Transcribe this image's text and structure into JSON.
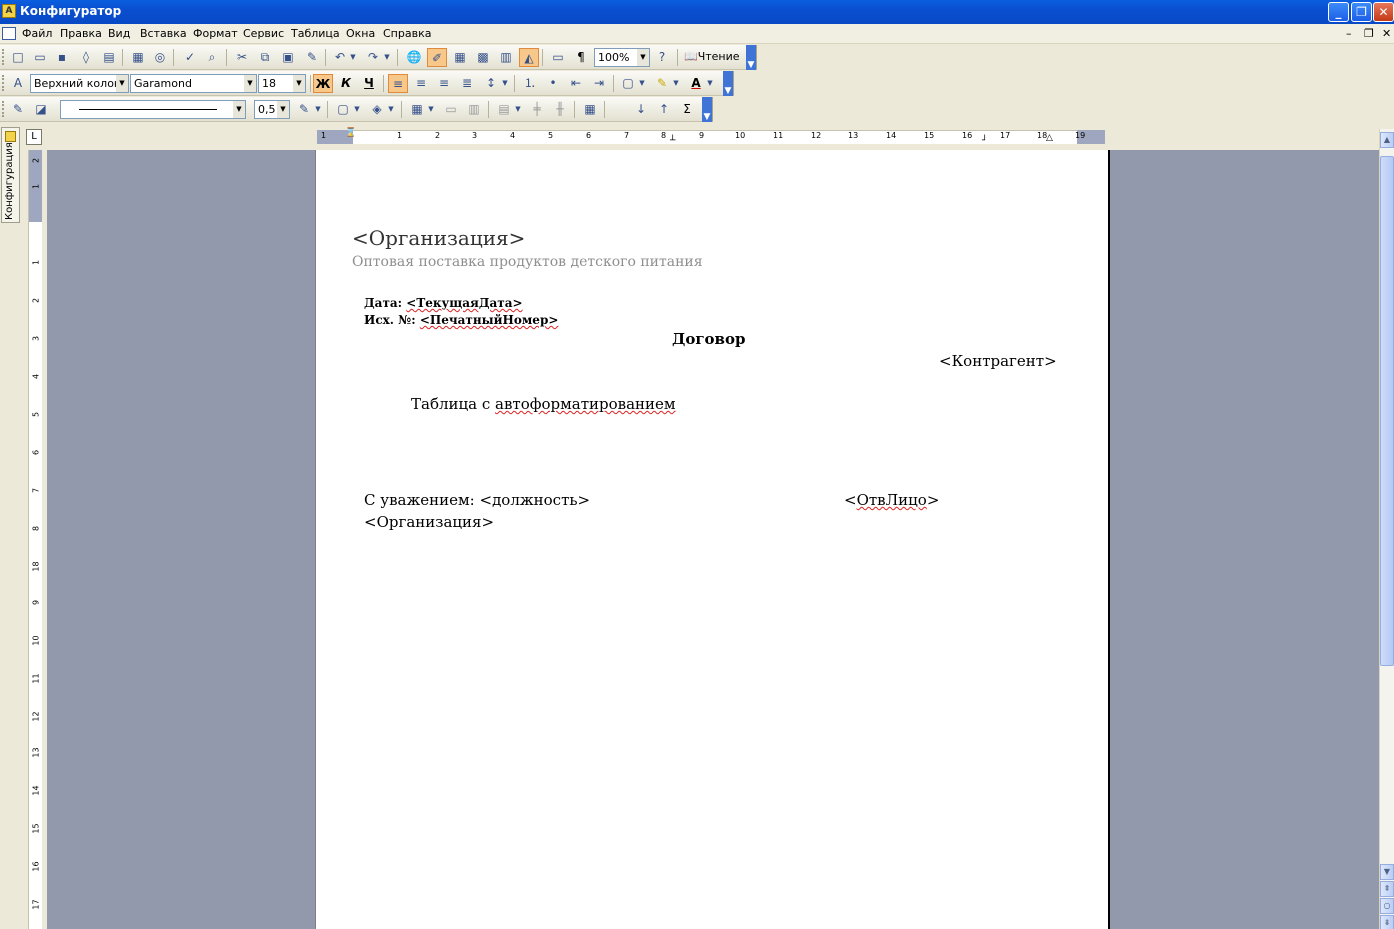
{
  "window": {
    "title": "Конфигуратор"
  },
  "menu": [
    "Файл",
    "Правка",
    "Вид",
    "Вставка",
    "Формат",
    "Сервис",
    "Таблица",
    "Окна",
    "Справка"
  ],
  "standard_toolbar": {
    "zoom": "100%",
    "reading_label": "Чтение"
  },
  "format_toolbar": {
    "style": "Верхний колонт",
    "font": "Garamond",
    "size": "18",
    "bold": "Ж",
    "italic": "К",
    "underline": "Ч"
  },
  "drawing_toolbar": {
    "line_width": "0,5",
    "sum_symbol": "Σ"
  },
  "sidebar": {
    "tab_label": "Конфигурация"
  },
  "ruler": {
    "h_numbers": [
      "1",
      "1",
      "2",
      "3",
      "4",
      "5",
      "6",
      "7",
      "8",
      "9",
      "10",
      "11",
      "12",
      "13",
      "14",
      "15",
      "16",
      "17",
      "18",
      "19"
    ],
    "v_numbers": [
      "2",
      "1",
      "1",
      "2",
      "3",
      "4",
      "5",
      "6",
      "7",
      "8",
      "9",
      "10",
      "11",
      "12",
      "13",
      "14",
      "15",
      "16",
      "17",
      "18"
    ]
  },
  "document": {
    "org": "<Организация>",
    "subtitle": "Оптовая поставка продуктов детского питания",
    "date_label": "Дата: ",
    "date_value": "<ТекущаяДата>",
    "num_label": "Исх. №: ",
    "num_value": "<ПечатныйНомер>",
    "title": "Договор",
    "counterparty": "<Контрагент>",
    "table_prefix": "Таблица с ",
    "table_word": "автоформатированием",
    "regards": "С уважением: <должность>",
    "person_open": "<",
    "person_name": "ОтвЛицо",
    "person_close": ">",
    "org_footer": "<Организация>"
  }
}
